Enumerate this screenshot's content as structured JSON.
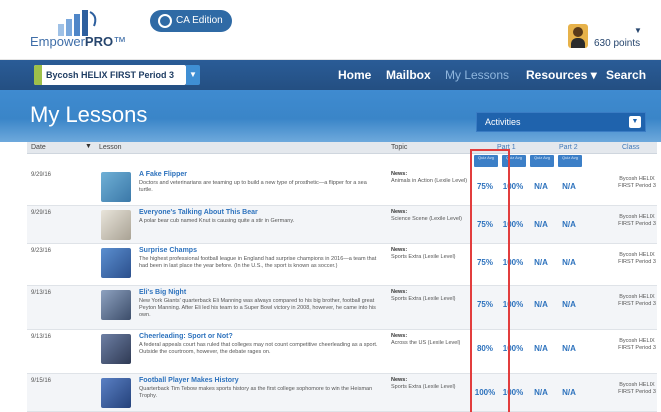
{
  "brand": {
    "logo_prefix": "Empower",
    "logo_suffix": "PRO",
    "logo_tm": "™",
    "edition_label": "CA Edition"
  },
  "user": {
    "points": "630 points"
  },
  "nav": {
    "class_select_value": "Bycosh HELIX FIRST Period 3",
    "items": [
      "Home",
      "Mailbox",
      "My Lessons",
      "Resources ▾",
      "Search"
    ],
    "active_index": 2
  },
  "banner": {
    "title": "My Lessons",
    "activities_label": "Activities"
  },
  "table": {
    "headers": {
      "date": "Date",
      "lesson": "Lesson",
      "topic": "Topic",
      "part1": "Part 1",
      "part2": "Part 2",
      "class": "Class"
    },
    "subheaders": [
      "Quiz Avg",
      "Quiz Avg",
      "Quiz Avg",
      "Quiz Avg"
    ],
    "rows": [
      {
        "date": "9/29/16",
        "title": "A Fake Flipper",
        "desc": "Doctors and veterinarians are teaming up to build a new type of prosthetic—a flipper for a sea turtle.",
        "topic_label": "News:",
        "topic_text": "Animals in Action (Lexile Level)",
        "scores": [
          "75%",
          "100%",
          "N/A",
          "N/A"
        ],
        "class": "Bycosh HELIX FIRST Period 3",
        "thumb_color": "#4e8fb8"
      },
      {
        "date": "9/29/16",
        "title": "Everyone's Talking About This Bear",
        "desc": "A polar bear cub named Knut is causing quite a stir in Germany.",
        "topic_label": "News:",
        "topic_text": "Science Scene (Lexile Level)",
        "scores": [
          "75%",
          "100%",
          "N/A",
          "N/A"
        ],
        "class": "Bycosh HELIX FIRST Period 3",
        "thumb_color": "#c9c4b8"
      },
      {
        "date": "9/23/16",
        "title": "Surprise Champs",
        "desc": "The highest professional football league in England had surprise champions in 2016—a team that had been in last place the year before. (In the U.S., the sport is known as soccer.)",
        "topic_label": "News:",
        "topic_text": "Sports Extra (Lexile Level)",
        "scores": [
          "75%",
          "100%",
          "N/A",
          "N/A"
        ],
        "class": "Bycosh HELIX FIRST Period 3",
        "thumb_color": "#3b69b0"
      },
      {
        "date": "9/13/16",
        "title": "Eli's Big Night",
        "desc": "New York Giants' quarterback Eli Manning was always compared to his big brother, football great Peyton Manning. After Eli led his team to a Super Bowl victory in 2008, however, he came into his own.",
        "topic_label": "News:",
        "topic_text": "Sports Extra (Lexile Level)",
        "scores": [
          "75%",
          "100%",
          "N/A",
          "N/A"
        ],
        "class": "Bycosh HELIX FIRST Period 3",
        "thumb_color": "#5b6f8c"
      },
      {
        "date": "9/13/16",
        "title": "Cheerleading: Sport or Not?",
        "desc": "A federal appeals court has ruled that colleges may not count competitive cheerleading as a sport. Outside the courtroom, however, the debate rages on.",
        "topic_label": "News:",
        "topic_text": "Across the US (Lexile Level)",
        "scores": [
          "80%",
          "100%",
          "N/A",
          "N/A"
        ],
        "class": "Bycosh HELIX FIRST Period 3",
        "thumb_color": "#4d5a78"
      },
      {
        "date": "9/15/16",
        "title": "Football Player Makes History",
        "desc": "Quarterback Tim Tebow makes sports history as the first college sophomore to win the Heisman Trophy.",
        "topic_label": "News:",
        "topic_text": "Sports Extra (Lexile Level)",
        "scores": [
          "100%",
          "100%",
          "N/A",
          "N/A"
        ],
        "class": "Bycosh HELIX FIRST Period 3",
        "thumb_color": "#3a5ea6"
      }
    ]
  },
  "colors": {
    "nav_bg": "#244f82",
    "banner_bg": "#3f8bd0",
    "accent_link": "#2d72bd",
    "highlight": "#e23d3d"
  }
}
